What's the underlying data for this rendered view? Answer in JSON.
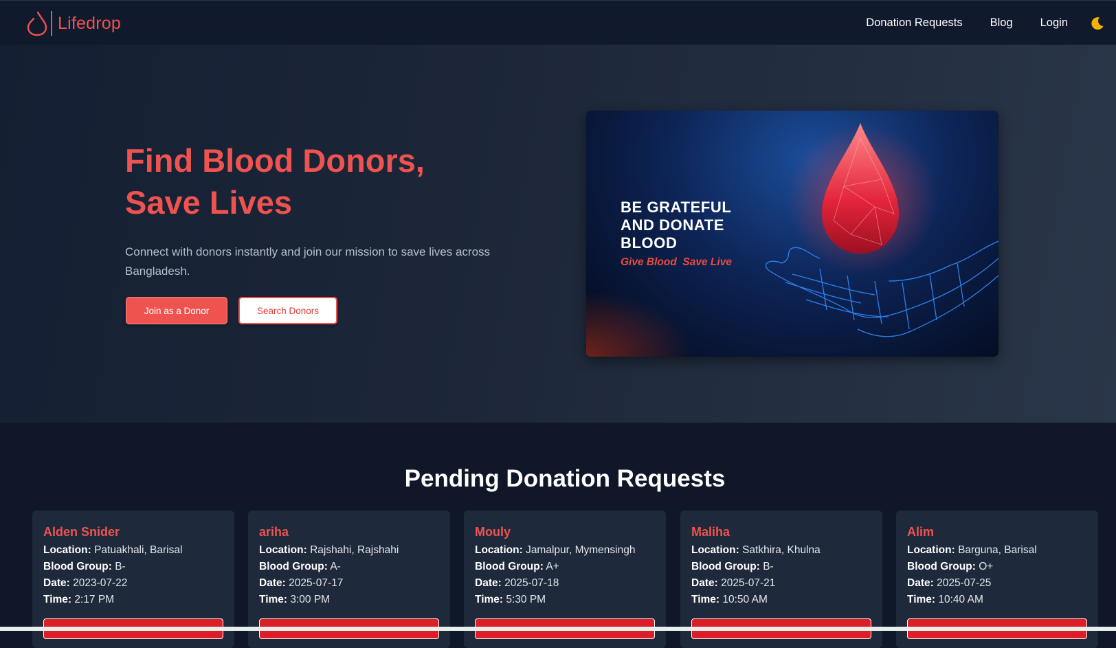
{
  "nav": {
    "brand": "Lifedrop",
    "links": [
      "Donation Requests",
      "Blog",
      "Login"
    ],
    "theme_icon": "moon-icon",
    "accent_color": "#ef5350",
    "moon_color": "#f5b400"
  },
  "hero": {
    "title_line1": "Find Blood Donors,",
    "title_line2": "Save Lives",
    "subtitle": "Connect with donors instantly and join our mission to save lives across Bangladesh.",
    "primary_button": "Join as a Donor",
    "secondary_button": "Search Donors",
    "banner": {
      "headline_line1": "BE GRATEFUL",
      "headline_line2": "AND DONATE",
      "headline_line3": "BLOOD",
      "tagline": "Give Blood  Save Live"
    }
  },
  "requests": {
    "section_title": "Pending Donation Requests",
    "labels": {
      "location": "Location:",
      "blood_group": "Blood Group:",
      "date": "Date:",
      "time": "Time:"
    },
    "items": [
      {
        "name": "Alden Snider",
        "location": "Patuakhali, Barisal",
        "blood_group": "B-",
        "date": "2023-07-22",
        "time": "2:17 PM"
      },
      {
        "name": "ariha",
        "location": "Rajshahi, Rajshahi",
        "blood_group": "A-",
        "date": "2025-07-17",
        "time": "3:00 PM"
      },
      {
        "name": "Mouly",
        "location": "Jamalpur, Mymensingh",
        "blood_group": "A+",
        "date": "2025-07-18",
        "time": "5:30 PM"
      },
      {
        "name": "Maliha",
        "location": "Satkhira, Khulna",
        "blood_group": "B-",
        "date": "2025-07-21",
        "time": "10:50 AM"
      },
      {
        "name": "Alim",
        "location": "Barguna, Barisal",
        "blood_group": "O+",
        "date": "2025-07-25",
        "time": "10:40 AM"
      }
    ]
  }
}
